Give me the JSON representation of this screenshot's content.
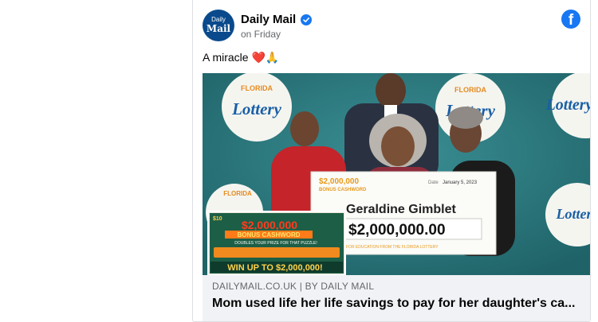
{
  "post": {
    "page_name": "Daily Mail",
    "avatar_line1": "Daily",
    "avatar_line2": "Mail",
    "timestamp": "on Friday",
    "text": "A miracle ❤️🙏"
  },
  "image": {
    "lottery_word": "Lottery",
    "florida_word": "FLORIDA",
    "check_prize_line1": "$2,000,000",
    "check_prize_line2": "BONUS CASHWORD",
    "check_date_label": "Date",
    "check_date": "January 5, 2023",
    "payee": "Geraldine Gimblet",
    "amount": "$2,000,000.00",
    "check_memo": "FOR EDUCATION FROM THE FLORIDA LOTTERY",
    "ticket_top": "$10",
    "ticket_title": "$2,000,000",
    "ticket_subtitle": "BONUS CASHWORD",
    "ticket_tagline": "DOUBLES YOUR PRIZE FOR THAT PUZZLE!",
    "ticket_win": "WIN UP TO $2,000,000!"
  },
  "link": {
    "domain": "DAILYMAIL.CO.UK",
    "separator": "|",
    "byline": "BY DAILY MAIL",
    "headline": "Mom used life her life savings to pay for her daughter's ca..."
  },
  "colors": {
    "facebook_blue": "#1877f2",
    "avatar_bg": "#0a4a8c",
    "footer_bg": "#f0f2f5",
    "backdrop_teal": "#2f7f84"
  },
  "icons": {
    "verified": "verified-badge-icon",
    "facebook": "facebook-logo-icon"
  }
}
